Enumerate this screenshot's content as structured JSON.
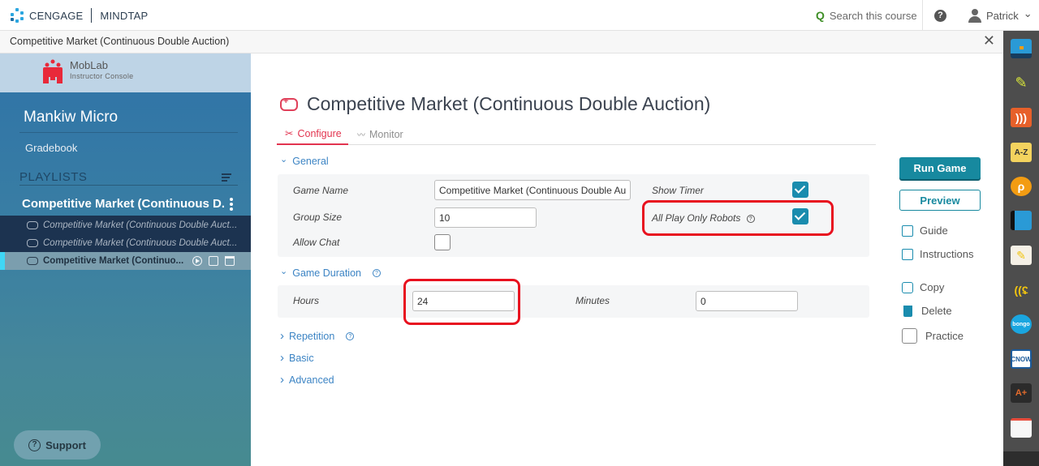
{
  "topbar": {
    "brand_left": "CENGAGE",
    "brand_right": "MINDTAP",
    "search_placeholder": "Search this course",
    "help_glyph": "?",
    "user_name": "Patrick",
    "user_chevron": "⌄"
  },
  "titlebar": {
    "title": "Competitive Market (Continuous Double Auction)",
    "close_glyph": "✕"
  },
  "sidebar": {
    "app_name": "MobLab",
    "app_subtitle": "Instructor Console",
    "course": "Mankiw Micro",
    "gradebook": "Gradebook",
    "playlists_header": "PLAYLISTS",
    "playlist_title": "Competitive Market (Continuous D...",
    "games": [
      {
        "label": "Competitive Market (Continuous Double Auct...",
        "active": false
      },
      {
        "label": "Competitive Market (Continuous Double Auct...",
        "active": false
      },
      {
        "label": "Competitive Market (Continuo...",
        "active": true
      }
    ],
    "support": "Support",
    "support_glyph": "?"
  },
  "main": {
    "title": "Competitive Market (Continuous Double Auction)",
    "tabs": [
      {
        "label": "Configure",
        "icon": "✂",
        "active": true
      },
      {
        "label": "Monitor",
        "icon": "〰",
        "active": false
      }
    ],
    "sections": {
      "general": {
        "label": "General",
        "expanded": true,
        "fields": {
          "game_name_label": "Game Name",
          "game_name_value": "Competitive Market (Continuous Double Auction)",
          "group_size_label": "Group Size",
          "group_size_value": "10",
          "allow_chat_label": "Allow Chat",
          "allow_chat_checked": false,
          "show_timer_label": "Show Timer",
          "show_timer_checked": true,
          "all_play_robots_label": "All Play Only Robots",
          "all_play_robots_checked": true
        }
      },
      "game_duration": {
        "label": "Game Duration",
        "expanded": true,
        "hours_label": "Hours",
        "hours_value": "24",
        "minutes_label": "Minutes",
        "minutes_value": "0"
      },
      "repetition": {
        "label": "Repetition",
        "expanded": false
      },
      "basic": {
        "label": "Basic",
        "expanded": false
      },
      "advanced": {
        "label": "Advanced",
        "expanded": false
      }
    },
    "chev_down": "⌄",
    "chev_right": "›",
    "help_glyph": "?"
  },
  "actions": {
    "run_game": "Run Game",
    "preview": "Preview",
    "guide": "Guide",
    "instructions": "Instructions",
    "copy": "Copy",
    "delete": "Delete",
    "practice": "Practice",
    "practice_checked": false
  },
  "dock": {
    "items": [
      "briefcase",
      "highlighter",
      "rss",
      "A-Z",
      "bookmark-circle",
      "book",
      "notes",
      "speech",
      "bongo",
      "CNOW",
      "A+",
      "flashcards"
    ],
    "az_label": "A-Z",
    "cnow_label": "CNOW",
    "aplus_label": "A+",
    "bongo_label": "bongo"
  },
  "colors": {
    "accent_red": "#e2344f",
    "teal": "#17899f",
    "link_blue": "#3c84c4",
    "annotation_red": "#e8111f"
  }
}
